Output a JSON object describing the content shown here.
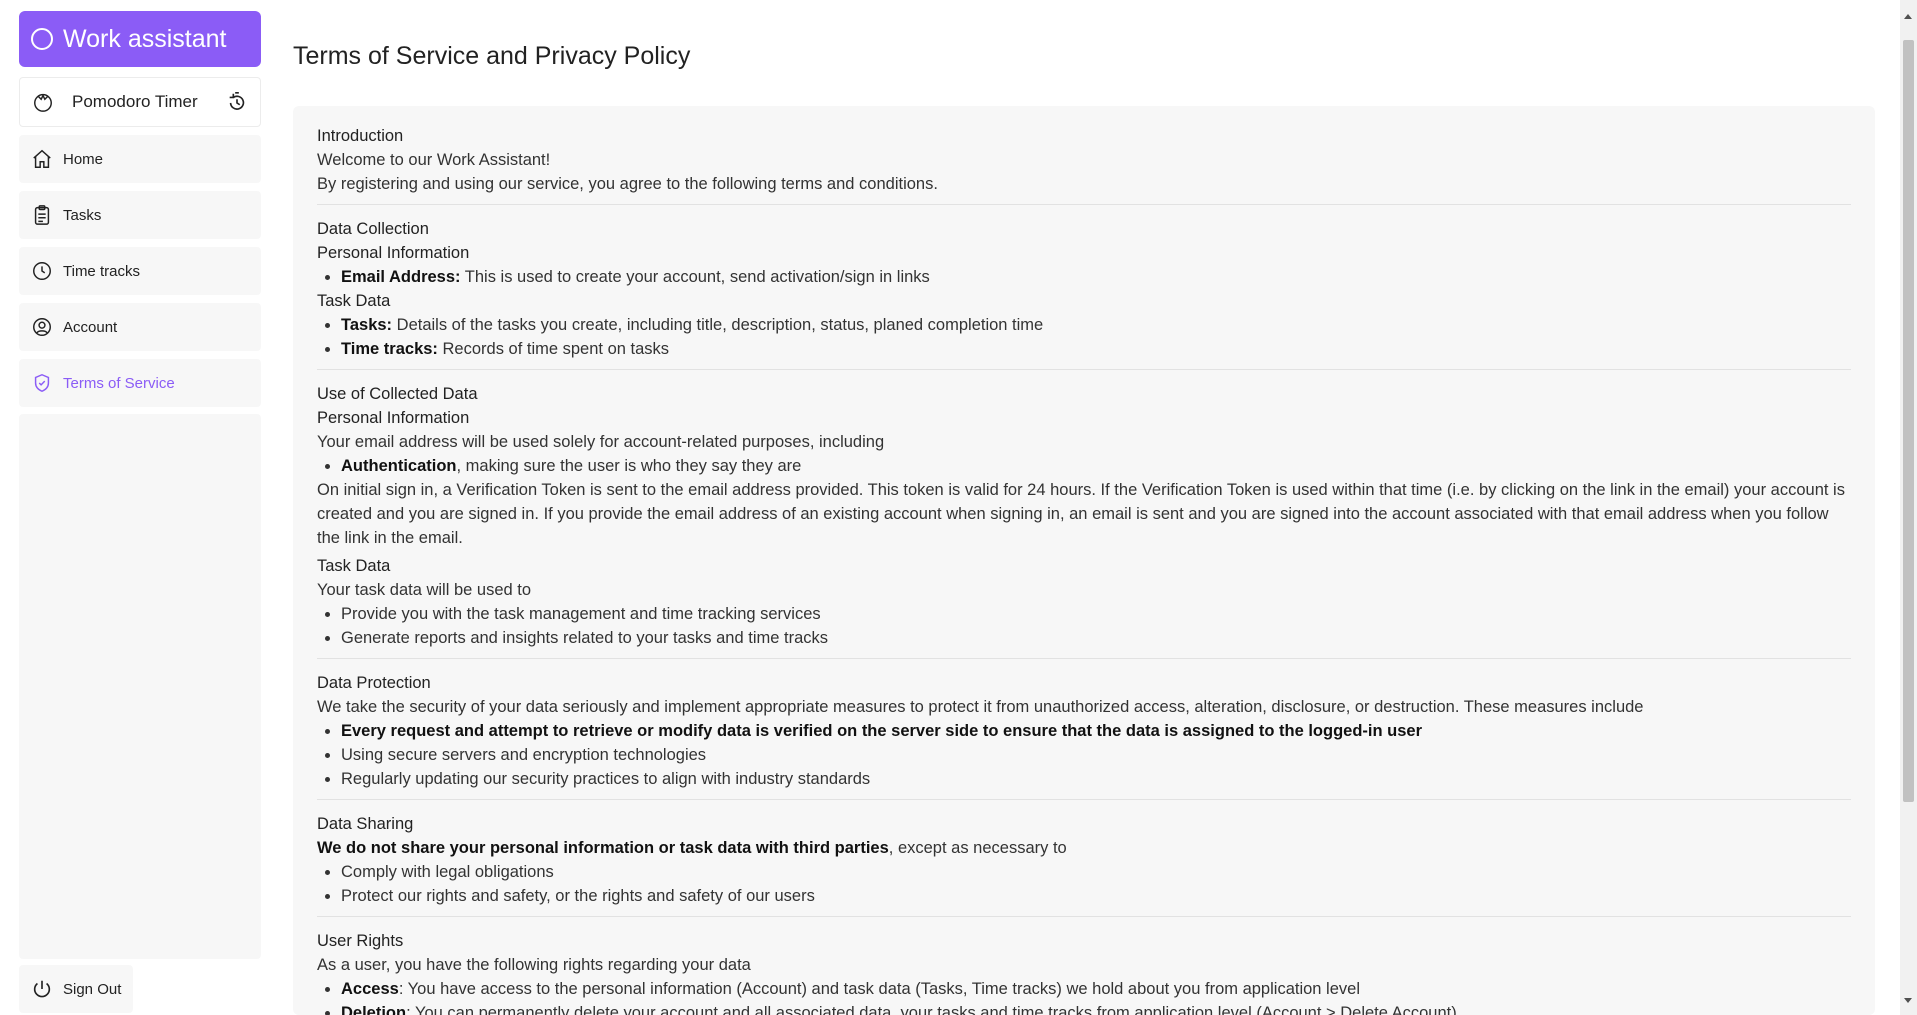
{
  "sidebar": {
    "brand": "Work assistant",
    "pomodoro_label": "Pomodoro Timer",
    "items": [
      {
        "label": "Home",
        "icon": "home-icon"
      },
      {
        "label": "Tasks",
        "icon": "clipboard-icon"
      },
      {
        "label": "Time tracks",
        "icon": "clock-icon"
      },
      {
        "label": "Account",
        "icon": "user-circle-icon"
      },
      {
        "label": "Terms of Service",
        "icon": "shield-check-icon",
        "active": true
      }
    ],
    "signout_label": "Sign Out"
  },
  "colors": {
    "accent": "#8b5cf6"
  },
  "page": {
    "title": "Terms of Service and Privacy Policy",
    "intro": {
      "title": "Introduction",
      "lines": [
        "Welcome to our Work Assistant!",
        "By registering and using our service, you agree to the following terms and conditions."
      ]
    },
    "collection": {
      "title": "Data Collection",
      "personal_title": "Personal Information",
      "email_bold": "Email Address:",
      "email_text": " This is used to create your account, send activation/sign in links",
      "task_title": "Task Data",
      "tasks_bold": "Tasks:",
      "tasks_text": " Details of the tasks you create, including title, description, status, planed completion time",
      "tracks_bold": "Time tracks:",
      "tracks_text": " Records of time spent on tasks"
    },
    "use": {
      "title": "Use of Collected Data",
      "personal_title": "Personal Information",
      "personal_text": "Your email address will be used solely for account-related purposes, including",
      "auth_bold": "Authentication",
      "auth_text": ", making sure the user is who they say they are",
      "token_text": "On initial sign in, a Verification Token is sent to the email address provided. This token is valid for 24 hours. If the Verification Token is used within that time (i.e. by clicking on the link in the email) your account is created and you are signed in. If you provide the email address of an existing account when signing in, an email is sent and you are signed into the account associated with that email address when you follow the link in the email.",
      "task_title": "Task Data",
      "task_text": "Your task data will be used to",
      "task_items": [
        "Provide you with the task management and time tracking services",
        "Generate reports and insights related to your tasks and time tracks"
      ]
    },
    "protection": {
      "title": "Data Protection",
      "text": "We take the security of your data seriously and implement appropriate measures to protect it from unauthorized access, alteration, disclosure, or destruction. These measures include",
      "bold_item": "Every request and attempt to retrieve or modify data is verified on the server side to ensure that the data is assigned to the logged-in user",
      "items": [
        "Using secure servers and encryption technologies",
        "Regularly updating our security practices to align with industry standards"
      ]
    },
    "sharing": {
      "title": "Data Sharing",
      "bold": "We do not share your personal information or task data with third parties",
      "text": ", except as necessary to",
      "items": [
        "Comply with legal obligations",
        "Protect our rights and safety, or the rights and safety of our users"
      ]
    },
    "rights": {
      "title": "User Rights",
      "text": "As a user, you have the following rights regarding your data",
      "access_bold": "Access",
      "access_text": ": You have access to the personal information (Account) and task data (Tasks, Time tracks) we hold about you from application level",
      "deletion_bold": "Deletion",
      "deletion_text": ": You can permanently delete your account and all associated data, your tasks and time tracks from application level (Account > Delete Account)"
    }
  }
}
